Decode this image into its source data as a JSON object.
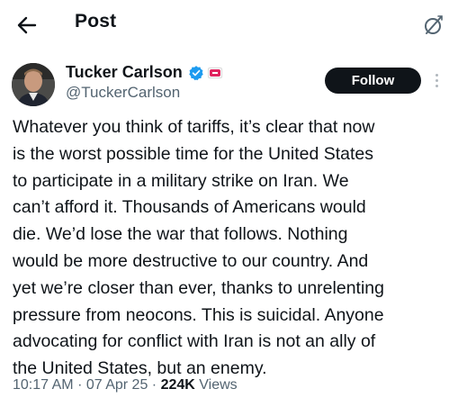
{
  "header": {
    "back_icon": "arrow-left-icon",
    "title": "Post",
    "grok_icon": "grok-icon"
  },
  "author": {
    "name": "Tucker Carlson",
    "handle": "@TuckerCarlson",
    "verified_icon": "verified-badge-icon",
    "verified_color": "#1d9bf0",
    "affiliate_badge_icon": "affiliate-badge-icon"
  },
  "actions": {
    "follow_label": "Follow",
    "more_icon": "more-vertical-icon"
  },
  "tweet": {
    "lines": [
      "Whatever you think of tariffs, it’s clear that now",
      "is the worst possible time for the United States",
      "to participate in a military strike on Iran. We",
      "can’t afford it. Thousands of Americans would",
      "die. We’d lose the war that follows. Nothing",
      "would be more destructive to our country. And",
      "yet we’re closer than ever, thanks to unrelenting",
      "pressure from neocons. This is suicidal. Anyone",
      "advocating for conflict with Iran is not an ally of",
      "the United States, but an enemy."
    ]
  },
  "meta": {
    "time": "10:17 AM",
    "separator": "·",
    "date": "07 Apr 25",
    "views_count": "224K",
    "views_label": "Views"
  },
  "colors": {
    "text": "#0f1419",
    "secondary_text": "#536471",
    "follow_bg": "#0f1419",
    "follow_text": "#ffffff"
  }
}
